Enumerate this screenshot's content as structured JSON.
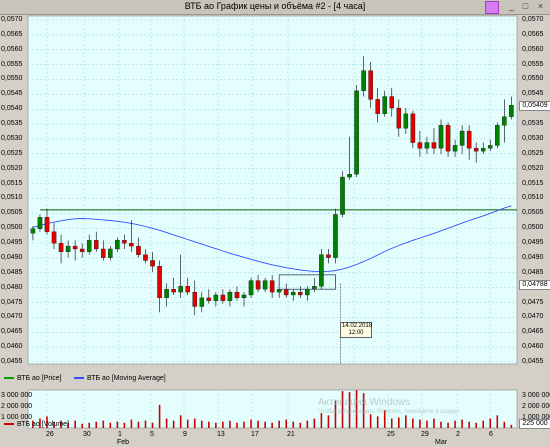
{
  "window": {
    "title": "ВТБ ао График цены и объёма #2 - [4 часа]",
    "minimize": "_",
    "restore": "□",
    "close": "×"
  },
  "colors": {
    "background": "#e4fefe",
    "grid": "#8fd6d6",
    "up": "#008000",
    "down": "#e00000",
    "ma": "#3050ff",
    "hline": "#006000",
    "volume": "#cc0000"
  },
  "price_axis": {
    "ticks": [
      "0,0570",
      "0,0565",
      "0,0560",
      "0,0555",
      "0,0550",
      "0,0545",
      "0,0540",
      "0,0535",
      "0,0530",
      "0,0525",
      "0,0520",
      "0,0515",
      "0,0510",
      "0,0505",
      "0,0500",
      "0,0495",
      "0,0490",
      "0,0485",
      "0,0480",
      "0,0475",
      "0,0470",
      "0,0465",
      "0,0460",
      "0,0455"
    ],
    "current_label": "0,05409",
    "secondary_label": "0,04788"
  },
  "legend": {
    "price": "ВТБ ао [Price]",
    "ma": "ВТБ ао [Moving Average]",
    "volume": "ВТБ ао [Volume]"
  },
  "volume_axis": {
    "ticks": [
      "3 000 000",
      "2 000 000",
      "1 000 000"
    ],
    "right_ticks": [
      "3 000 000",
      "2 000 000",
      "1 000 000"
    ],
    "current_label": "225 000"
  },
  "watermark": {
    "line1": "Активация Windows",
    "line2": "Чтобы активировать Windows, перейдите в раздел"
  },
  "crosshair": {
    "date": "14.02.2018",
    "time": "12:00"
  },
  "x_axis": {
    "labels": [
      "26",
      "30",
      "1",
      "5",
      "9",
      "13",
      "17",
      "21",
      "25",
      "29",
      "2",
      "6"
    ],
    "months": [
      "Feb",
      "Mar"
    ]
  },
  "chart_data": {
    "type": "candlestick",
    "ylim": [
      0.0451,
      0.0572
    ],
    "hline": 0.05046,
    "candles": [
      {
        "o": 0.04965,
        "h": 0.0499,
        "l": 0.0494,
        "c": 0.0498
      },
      {
        "o": 0.0498,
        "h": 0.0503,
        "l": 0.0497,
        "c": 0.0502
      },
      {
        "o": 0.0502,
        "h": 0.0505,
        "l": 0.0496,
        "c": 0.0497
      },
      {
        "o": 0.0497,
        "h": 0.05,
        "l": 0.0491,
        "c": 0.0493
      },
      {
        "o": 0.0493,
        "h": 0.0496,
        "l": 0.0486,
        "c": 0.049
      },
      {
        "o": 0.049,
        "h": 0.0494,
        "l": 0.0488,
        "c": 0.0492
      },
      {
        "o": 0.0492,
        "h": 0.0494,
        "l": 0.0487,
        "c": 0.0491
      },
      {
        "o": 0.0491,
        "h": 0.0493,
        "l": 0.0488,
        "c": 0.049
      },
      {
        "o": 0.049,
        "h": 0.0496,
        "l": 0.0489,
        "c": 0.0494
      },
      {
        "o": 0.0494,
        "h": 0.0497,
        "l": 0.049,
        "c": 0.0491
      },
      {
        "o": 0.0491,
        "h": 0.0494,
        "l": 0.0487,
        "c": 0.0488
      },
      {
        "o": 0.0488,
        "h": 0.0492,
        "l": 0.0487,
        "c": 0.0491
      },
      {
        "o": 0.0491,
        "h": 0.0495,
        "l": 0.049,
        "c": 0.0494
      },
      {
        "o": 0.0494,
        "h": 0.0496,
        "l": 0.0491,
        "c": 0.0493
      },
      {
        "o": 0.0493,
        "h": 0.0501,
        "l": 0.049,
        "c": 0.0492
      },
      {
        "o": 0.0492,
        "h": 0.0495,
        "l": 0.0488,
        "c": 0.0489
      },
      {
        "o": 0.0489,
        "h": 0.0491,
        "l": 0.0486,
        "c": 0.0487
      },
      {
        "o": 0.0487,
        "h": 0.049,
        "l": 0.0483,
        "c": 0.0485
      },
      {
        "o": 0.0485,
        "h": 0.0487,
        "l": 0.0469,
        "c": 0.0474
      },
      {
        "o": 0.0474,
        "h": 0.0479,
        "l": 0.0471,
        "c": 0.0477
      },
      {
        "o": 0.0477,
        "h": 0.0481,
        "l": 0.0475,
        "c": 0.0476
      },
      {
        "o": 0.0476,
        "h": 0.0489,
        "l": 0.0474,
        "c": 0.0478
      },
      {
        "o": 0.0478,
        "h": 0.0481,
        "l": 0.0475,
        "c": 0.0476
      },
      {
        "o": 0.0476,
        "h": 0.048,
        "l": 0.0468,
        "c": 0.0471
      },
      {
        "o": 0.0471,
        "h": 0.0476,
        "l": 0.0469,
        "c": 0.0474
      },
      {
        "o": 0.0474,
        "h": 0.0477,
        "l": 0.0472,
        "c": 0.0473
      },
      {
        "o": 0.0473,
        "h": 0.0476,
        "l": 0.0471,
        "c": 0.0475
      },
      {
        "o": 0.0475,
        "h": 0.0477,
        "l": 0.0472,
        "c": 0.0473
      },
      {
        "o": 0.0473,
        "h": 0.0477,
        "l": 0.0471,
        "c": 0.0476
      },
      {
        "o": 0.0476,
        "h": 0.0478,
        "l": 0.0473,
        "c": 0.0474
      },
      {
        "o": 0.0474,
        "h": 0.0476,
        "l": 0.0471,
        "c": 0.0475
      },
      {
        "o": 0.0475,
        "h": 0.0481,
        "l": 0.0474,
        "c": 0.048
      },
      {
        "o": 0.048,
        "h": 0.0482,
        "l": 0.0476,
        "c": 0.0477
      },
      {
        "o": 0.0477,
        "h": 0.0481,
        "l": 0.0476,
        "c": 0.048
      },
      {
        "o": 0.048,
        "h": 0.0482,
        "l": 0.0474,
        "c": 0.0476
      },
      {
        "o": 0.0476,
        "h": 0.0479,
        "l": 0.0474,
        "c": 0.0477
      },
      {
        "o": 0.0477,
        "h": 0.0479,
        "l": 0.0474,
        "c": 0.0475
      },
      {
        "o": 0.0475,
        "h": 0.0477,
        "l": 0.0473,
        "c": 0.0476
      },
      {
        "o": 0.0476,
        "h": 0.0478,
        "l": 0.0474,
        "c": 0.0475
      },
      {
        "o": 0.0475,
        "h": 0.0478,
        "l": 0.0473,
        "c": 0.0477
      },
      {
        "o": 0.0477,
        "h": 0.0481,
        "l": 0.0476,
        "c": 0.0478
      },
      {
        "o": 0.0478,
        "h": 0.0491,
        "l": 0.0477,
        "c": 0.0489
      },
      {
        "o": 0.0489,
        "h": 0.0491,
        "l": 0.0486,
        "c": 0.0488
      },
      {
        "o": 0.0488,
        "h": 0.0505,
        "l": 0.0486,
        "c": 0.0503
      },
      {
        "o": 0.0503,
        "h": 0.0518,
        "l": 0.0502,
        "c": 0.0516
      },
      {
        "o": 0.0516,
        "h": 0.053,
        "l": 0.0515,
        "c": 0.0517
      },
      {
        "o": 0.0517,
        "h": 0.0548,
        "l": 0.0516,
        "c": 0.0546
      },
      {
        "o": 0.0546,
        "h": 0.0558,
        "l": 0.0544,
        "c": 0.0553
      },
      {
        "o": 0.0553,
        "h": 0.0556,
        "l": 0.054,
        "c": 0.0543
      },
      {
        "o": 0.0543,
        "h": 0.0547,
        "l": 0.0535,
        "c": 0.0538
      },
      {
        "o": 0.0538,
        "h": 0.0546,
        "l": 0.0537,
        "c": 0.0544
      },
      {
        "o": 0.0544,
        "h": 0.0547,
        "l": 0.0537,
        "c": 0.054
      },
      {
        "o": 0.054,
        "h": 0.0543,
        "l": 0.053,
        "c": 0.0533
      },
      {
        "o": 0.0533,
        "h": 0.054,
        "l": 0.0531,
        "c": 0.0538
      },
      {
        "o": 0.0538,
        "h": 0.0539,
        "l": 0.0526,
        "c": 0.0528
      },
      {
        "o": 0.0528,
        "h": 0.0532,
        "l": 0.0523,
        "c": 0.0526
      },
      {
        "o": 0.0526,
        "h": 0.053,
        "l": 0.0524,
        "c": 0.0528
      },
      {
        "o": 0.0528,
        "h": 0.0533,
        "l": 0.0524,
        "c": 0.0526
      },
      {
        "o": 0.0526,
        "h": 0.0536,
        "l": 0.0524,
        "c": 0.0534
      },
      {
        "o": 0.0534,
        "h": 0.0535,
        "l": 0.0523,
        "c": 0.0525
      },
      {
        "o": 0.0525,
        "h": 0.0529,
        "l": 0.0523,
        "c": 0.0527
      },
      {
        "o": 0.0527,
        "h": 0.0534,
        "l": 0.0524,
        "c": 0.0532
      },
      {
        "o": 0.0532,
        "h": 0.0534,
        "l": 0.0522,
        "c": 0.0526
      },
      {
        "o": 0.0526,
        "h": 0.0528,
        "l": 0.0521,
        "c": 0.0525
      },
      {
        "o": 0.0525,
        "h": 0.0528,
        "l": 0.0524,
        "c": 0.0526
      },
      {
        "o": 0.0526,
        "h": 0.0529,
        "l": 0.0525,
        "c": 0.0527
      },
      {
        "o": 0.0527,
        "h": 0.0535,
        "l": 0.0526,
        "c": 0.0534
      },
      {
        "o": 0.0534,
        "h": 0.0543,
        "l": 0.0528,
        "c": 0.0537
      },
      {
        "o": 0.0537,
        "h": 0.0544,
        "l": 0.0536,
        "c": 0.0541
      }
    ],
    "moving_average": [
      0.04985,
      0.04992,
      0.04998,
      0.05003,
      0.05008,
      0.05012,
      0.05015,
      0.05016,
      0.05015,
      0.05013,
      0.05011,
      0.05009,
      0.05006,
      0.05003,
      0.04999,
      0.04994,
      0.04988,
      0.04982,
      0.04975,
      0.04967,
      0.04959,
      0.04951,
      0.04943,
      0.04935,
      0.04927,
      0.04919,
      0.04911,
      0.04903,
      0.04895,
      0.04888,
      0.04881,
      0.04874,
      0.04867,
      0.04861,
      0.04855,
      0.0485,
      0.04845,
      0.04841,
      0.04837,
      0.04834,
      0.04832,
      0.04831,
      0.04832,
      0.04835,
      0.0484,
      0.04847,
      0.04856,
      0.04866,
      0.04877,
      0.04889,
      0.04901,
      0.04912,
      0.04922,
      0.04931,
      0.0494,
      0.04948,
      0.04956,
      0.04964,
      0.04973,
      0.04982,
      0.04991,
      0.05,
      0.05009,
      0.05017,
      0.05025,
      0.05034,
      0.05043,
      0.05052,
      0.0506
    ],
    "volume_ylim": [
      0,
      3600000
    ],
    "volume": [
      700000,
      900000,
      1100000,
      600000,
      700000,
      500000,
      700000,
      400000,
      500000,
      600000,
      700000,
      500000,
      600000,
      500000,
      800000,
      600000,
      700000,
      500000,
      2200000,
      900000,
      700000,
      1200000,
      800000,
      900000,
      700000,
      600000,
      500000,
      600000,
      700000,
      500000,
      600000,
      800000,
      700000,
      600000,
      500000,
      700000,
      800000,
      600000,
      500000,
      700000,
      900000,
      1400000,
      1200000,
      2600000,
      3500000,
      3400000,
      3600000,
      3300000,
      1300000,
      1100000,
      1700000,
      900000,
      1000000,
      1200000,
      900000,
      800000,
      700000,
      900000,
      600000,
      500000,
      700000,
      800000,
      600000,
      500000,
      700000,
      900000,
      1200000,
      600000,
      300000
    ]
  }
}
